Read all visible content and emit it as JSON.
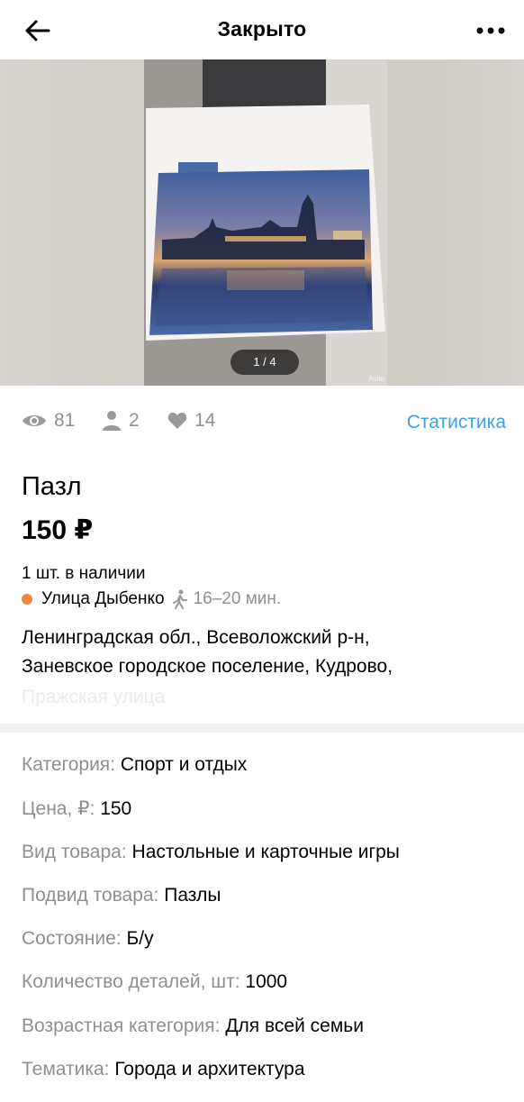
{
  "header": {
    "title": "Закрыто",
    "back_icon": "arrow-left-icon",
    "more_icon": "more-dots-icon"
  },
  "gallery": {
    "counter": "1 / 4",
    "watermark": "Avito"
  },
  "stats": {
    "views": "81",
    "favorites_users": "2",
    "likes": "14",
    "link_label": "Статистика",
    "link_color": "#3ba1e6"
  },
  "ad": {
    "title": "Пазл",
    "price": "150 ₽",
    "stock": "1 шт. в наличии",
    "metro_station": "Улица Дыбенко",
    "metro_color": "#e88a43",
    "walk_time": "16–20 мин.",
    "address_line1": "Ленинградская обл., Всеволожский р-н,",
    "address_line2": "Заневское городское поселение, Кудрово,",
    "address_line3": "Пражская улица"
  },
  "params": [
    {
      "label": "Категория:",
      "value": "Спорт и отдых"
    },
    {
      "label": "Цена, ₽:",
      "value": "150"
    },
    {
      "label": "Вид товара:",
      "value": "Настольные и карточные игры"
    },
    {
      "label": "Подвид товара:",
      "value": "Пазлы"
    },
    {
      "label": "Состояние:",
      "value": "Б/у"
    },
    {
      "label": "Количество деталей, шт:",
      "value": "1000"
    },
    {
      "label": "Возрастная категория:",
      "value": "Для всей семьи"
    },
    {
      "label": "Тематика:",
      "value": "Города и архитектура"
    }
  ]
}
